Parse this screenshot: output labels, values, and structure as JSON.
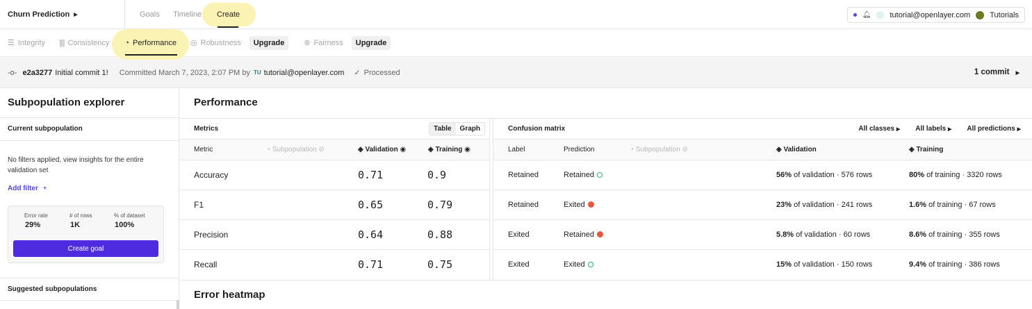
{
  "topbar": {
    "project_name": "Churn Prediction",
    "tabs": [
      {
        "label": "Goals"
      },
      {
        "label": "Timeline"
      },
      {
        "label": "Create"
      }
    ],
    "user_email": "tutorial@openlayer.com",
    "tutorials_label": "Tutorials"
  },
  "subnav": {
    "tabs": [
      {
        "label": "Integrity"
      },
      {
        "label": "Consistency"
      },
      {
        "label": "Performance"
      },
      {
        "label": "Robustness"
      },
      {
        "label": "Fairness"
      }
    ],
    "upgrade_label": "Upgrade"
  },
  "commit": {
    "hash": "e2a3277",
    "message": "Initial commit 1!",
    "committed": "Committed March 7, 2023, 2:07 PM by",
    "initials": "TU",
    "author": "tutorial@openlayer.com",
    "status": "Processed",
    "count": "1 commit"
  },
  "sidebar": {
    "title": "Subpopulation explorer",
    "current_label": "Current subpopulation",
    "description": "No filters applied, view insights for the entire validation set",
    "add_filter": "Add filter",
    "stats": [
      {
        "label": "Error rate",
        "value": "29%"
      },
      {
        "label": "# of rows",
        "value": "1K"
      },
      {
        "label": "% of dataset",
        "value": "100%"
      }
    ],
    "create_goal": "Create goal",
    "suggested_label": "Suggested subpopulations"
  },
  "performance": {
    "title": "Performance",
    "metrics_label": "Metrics",
    "toggle": {
      "table": "Table",
      "graph": "Graph"
    },
    "columns": {
      "metric": "Metric",
      "subpopulation": "Subpopulation",
      "validation": "Validation",
      "training": "Training"
    },
    "rows": [
      {
        "metric": "Accuracy",
        "validation": "0.71",
        "training": "0.9"
      },
      {
        "metric": "F1",
        "validation": "0.65",
        "training": "0.79"
      },
      {
        "metric": "Precision",
        "validation": "0.64",
        "training": "0.88"
      },
      {
        "metric": "Recall",
        "validation": "0.71",
        "training": "0.75"
      }
    ]
  },
  "confusion": {
    "title": "Confusion matrix",
    "filters": [
      "All classes",
      "All labels",
      "All predictions"
    ],
    "columns": {
      "label": "Label",
      "prediction": "Prediction",
      "subpopulation": "Subpopulation",
      "validation": "Validation",
      "training": "Training"
    },
    "rows": [
      {
        "label": "Retained",
        "prediction": "Retained",
        "status": "correct",
        "val_pct": "56%",
        "val_rest": "of validation · 576 rows",
        "train_pct": "80%",
        "train_rest": "of training · 3320 rows"
      },
      {
        "label": "Retained",
        "prediction": "Exited",
        "status": "wrong",
        "val_pct": "23%",
        "val_rest": "of validation · 241 rows",
        "train_pct": "1.6%",
        "train_rest": "of training · 67 rows"
      },
      {
        "label": "Exited",
        "prediction": "Retained",
        "status": "wrong",
        "val_pct": "5.8%",
        "val_rest": "of validation · 60 rows",
        "train_pct": "8.6%",
        "train_rest": "of training · 355 rows"
      },
      {
        "label": "Exited",
        "prediction": "Exited",
        "status": "correct",
        "val_pct": "15%",
        "val_rest": "of validation · 150 rows",
        "train_pct": "9.4%",
        "train_rest": "of training · 386 rows"
      }
    ]
  },
  "heatmap": {
    "title": "Error heatmap"
  },
  "colors": {
    "accent": "#4f2bdf",
    "highlight": "#fbf3b4",
    "correct": "#2fb36b",
    "wrong": "#e8553f"
  }
}
